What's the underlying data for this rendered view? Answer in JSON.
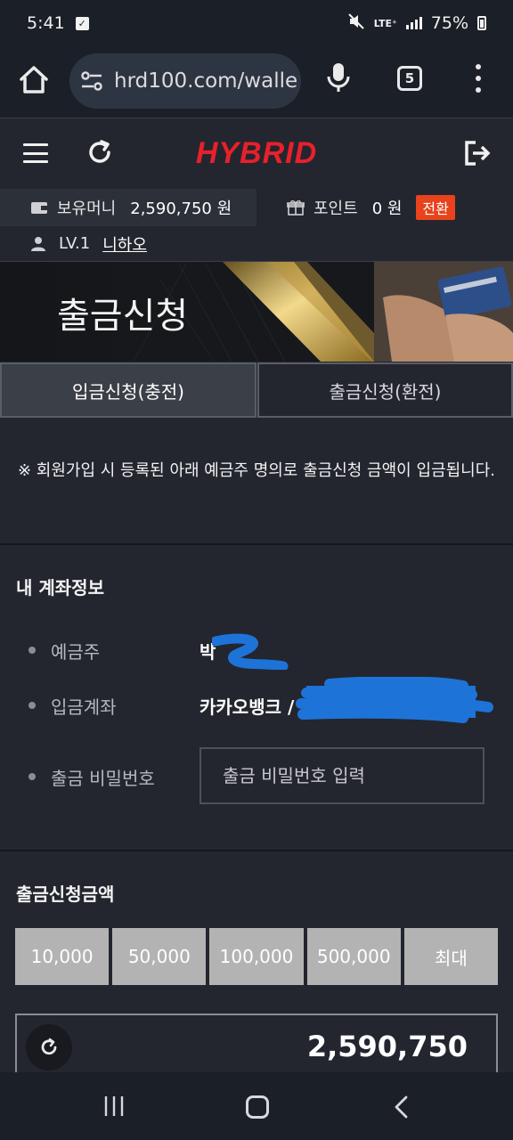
{
  "status": {
    "time": "5:41",
    "network": "LTE⁺",
    "battery": "75%"
  },
  "browser": {
    "url": "hrd100.com/walle",
    "tab_count": "5"
  },
  "site": {
    "logo": "HYBRID",
    "money_label": "보유머니",
    "money_value": "2,590,750 원",
    "point_label": "포인트",
    "point_value": "0 원",
    "exchange_label": "전환",
    "user_level": "LV.1",
    "user_name": "니하오"
  },
  "banner": {
    "title": "출금신청"
  },
  "tabs": {
    "deposit": "입금신청(충전)",
    "withdraw": "출금신청(환전)"
  },
  "notice": "※ 회원가입 시 등록된 아래 예금주 명의로 출금신청 금액이 입금됩니다.",
  "account": {
    "title": "내 계좌정보",
    "holder_label": "예금주",
    "holder_value": "박",
    "bank_label": "입금계좌",
    "bank_value": "카카오뱅크 /",
    "password_label": "출금 비밀번호",
    "password_placeholder": "출금 비밀번호 입력"
  },
  "amount": {
    "title": "출금신청금액",
    "buttons": [
      "10,000",
      "50,000",
      "100,000",
      "500,000",
      "최대"
    ],
    "value": "2,590,750"
  },
  "colors": {
    "logo_red": "#e8202a",
    "exchange_orange": "#e8431c",
    "redaction_blue": "#1e73d8"
  }
}
